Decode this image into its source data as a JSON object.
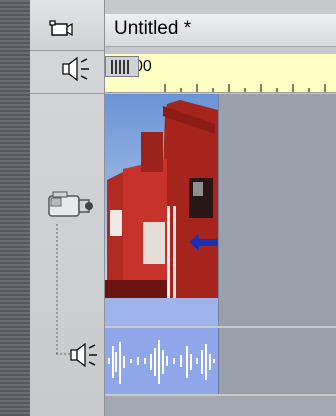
{
  "timeline": {
    "title": "Untitled *",
    "ruler_label": "00",
    "icons": [
      "video-track-icon",
      "audio-speaker-icon",
      "camcorder-icon",
      "audio-track-speaker-icon"
    ]
  },
  "colors": {
    "ruler_bg": "#ffffc4",
    "track_bg": "#9aa0aa",
    "video_clip_bg": "#9fb4ea",
    "audio_clip_bg": "#8fa7ea"
  }
}
